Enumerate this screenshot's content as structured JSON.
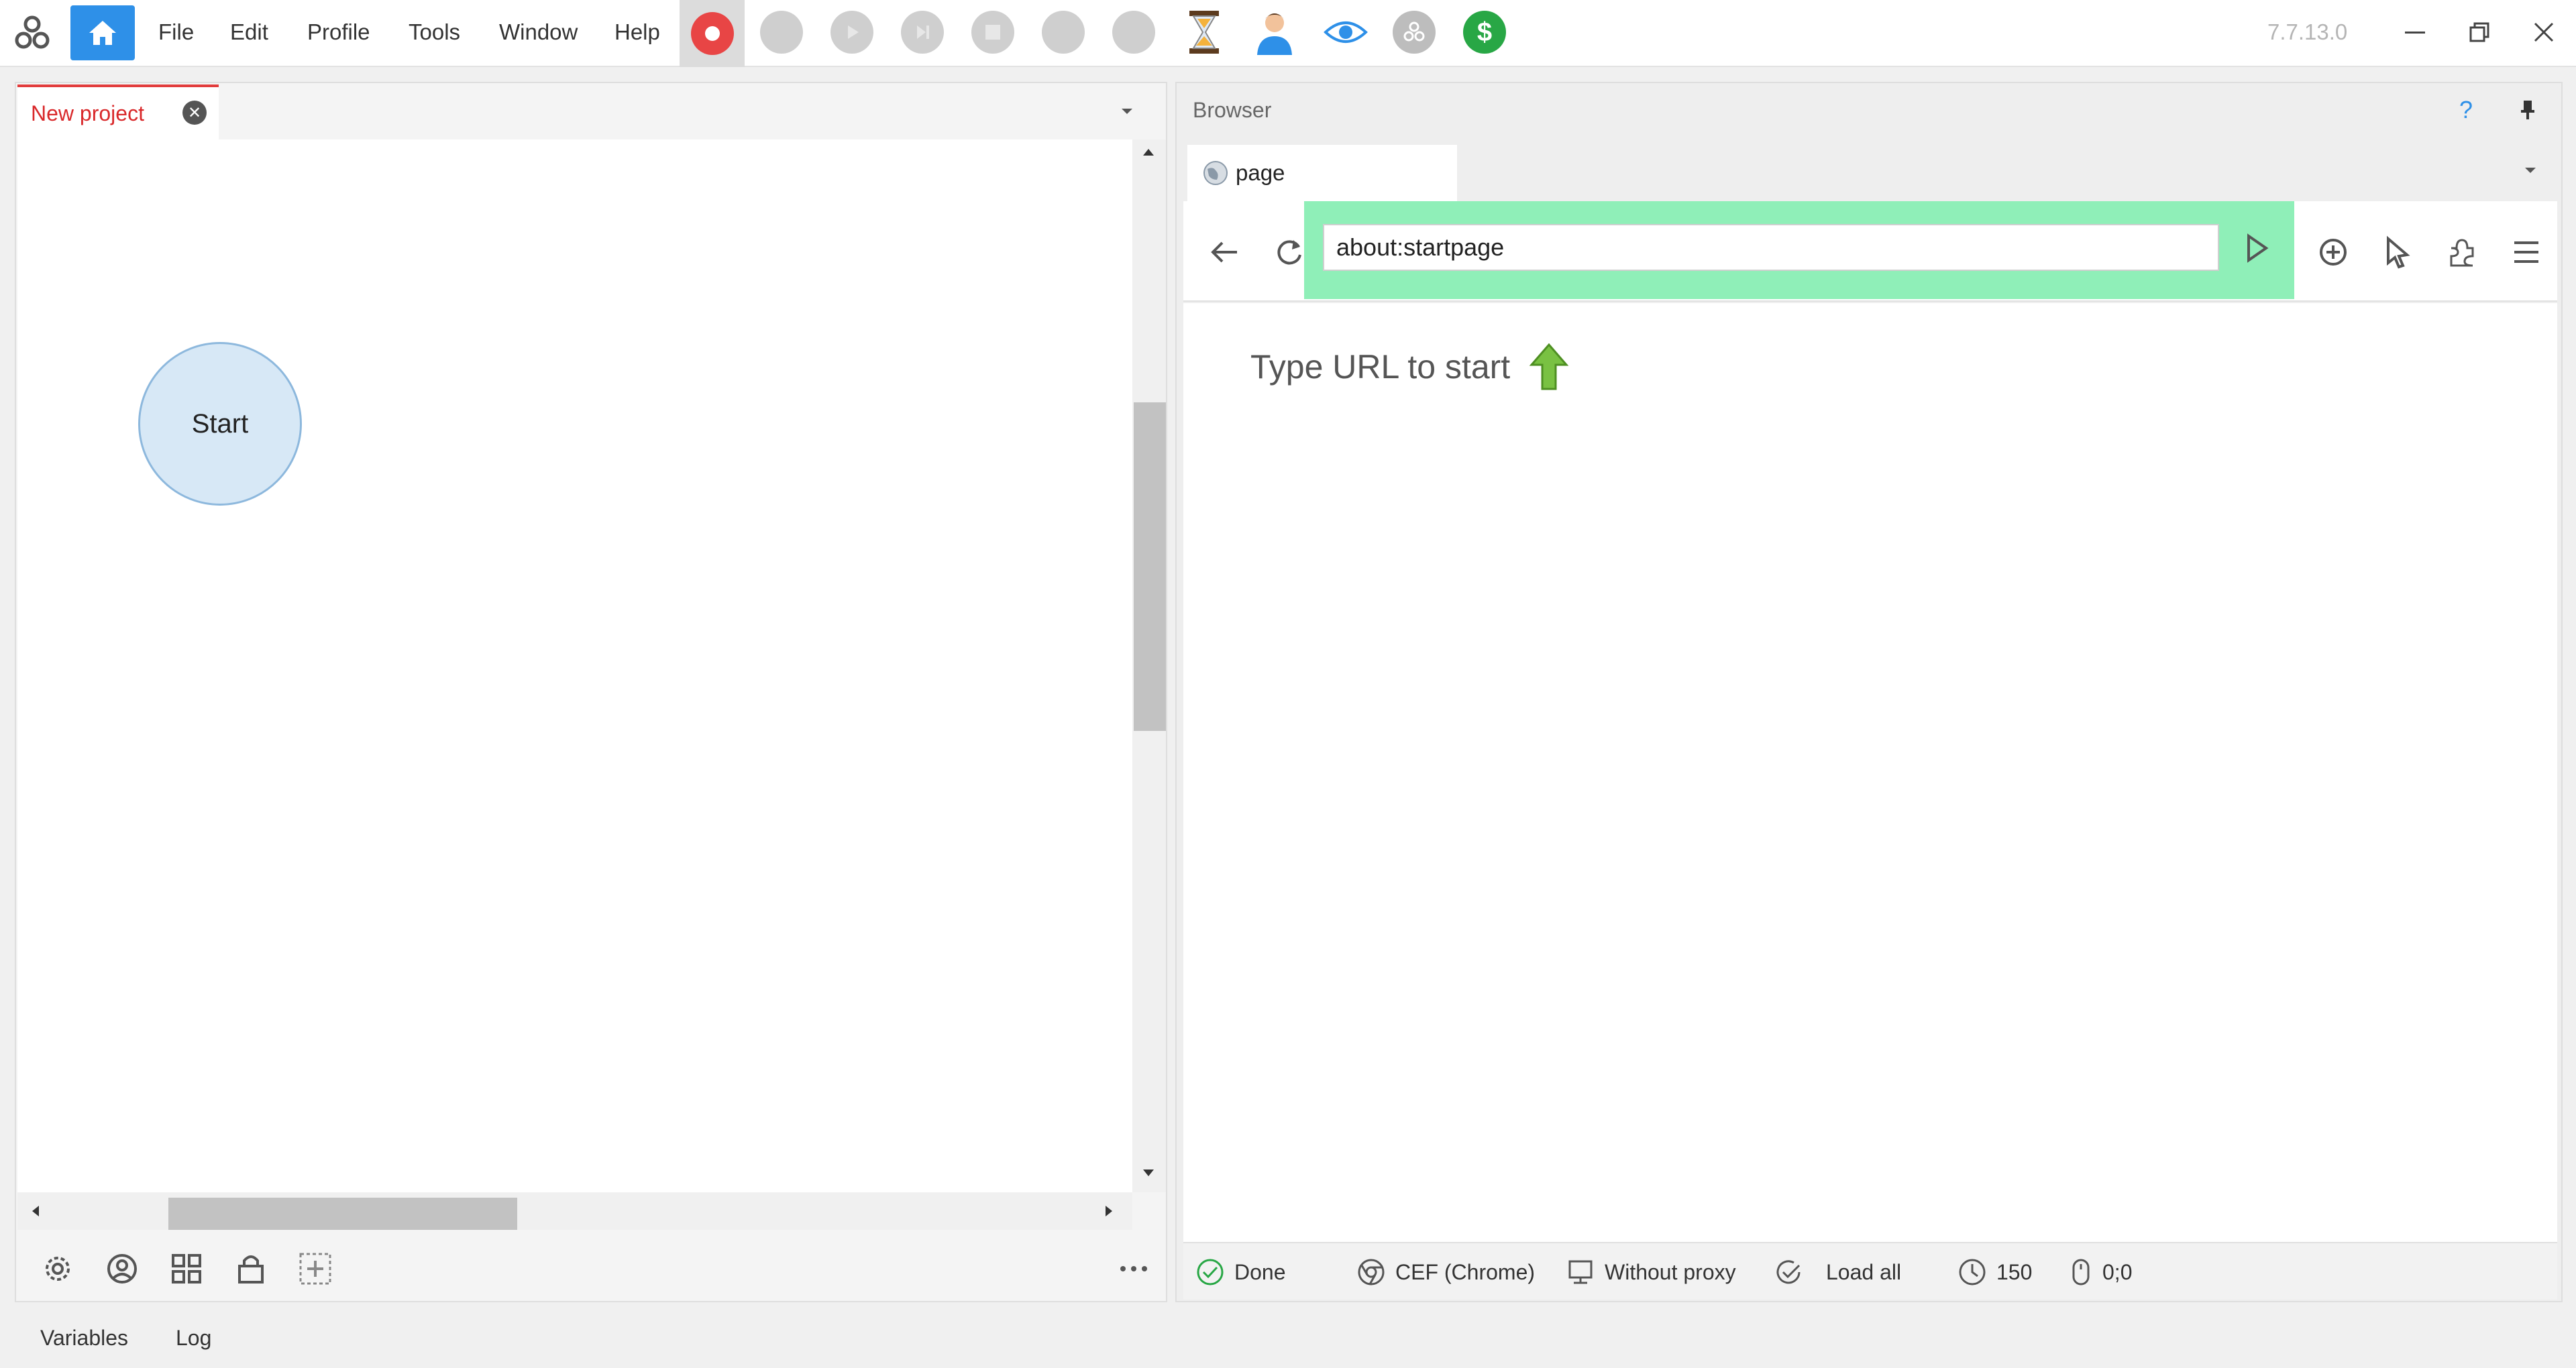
{
  "menu": {
    "items": [
      "File",
      "Edit",
      "Profile",
      "Tools",
      "Window",
      "Help"
    ]
  },
  "version": "7.7.13.0",
  "toolbar_icons": [
    "record-icon",
    "disabled-circle-icon",
    "play-icon",
    "step-icon",
    "stop-icon",
    "disabled-circle-icon",
    "disabled-circle-icon",
    "hourglass-icon",
    "user-icon",
    "eye-icon",
    "logo-grey-icon",
    "dollar-icon"
  ],
  "project": {
    "tab_label": "New project",
    "start_node_label": "Start"
  },
  "browser": {
    "header_title": "Browser",
    "help_label": "?",
    "tab_label": "page",
    "url_value": "about:startpage",
    "hint_text": "Type URL to start",
    "status": {
      "done": "Done",
      "engine": "CEF (Chrome)",
      "proxy": "Without proxy",
      "load": "Load all",
      "timeout": "150",
      "coords": "0;0"
    }
  },
  "bottom_tabs": [
    "Variables",
    "Log"
  ],
  "colors": {
    "accent": "#2e90e8",
    "record": "#e84545",
    "url_highlight": "#8fefb8",
    "tab_active_text": "#d9282a",
    "dollar": "#28a745"
  }
}
